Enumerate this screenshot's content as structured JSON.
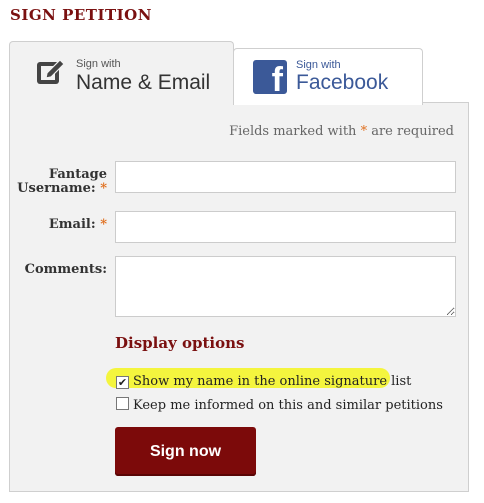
{
  "page": {
    "title": "SIGN PETITION"
  },
  "tabs": [
    {
      "small": "Sign with",
      "big": "Name & Email",
      "icon": "pencil-icon",
      "active": true
    },
    {
      "small": "Sign with",
      "big": "Facebook",
      "icon": "facebook-icon",
      "active": false
    }
  ],
  "form": {
    "required_note_before": "Fields marked with",
    "required_star": "*",
    "required_note_after": "are required",
    "fields": [
      {
        "label": "Fantage Username:",
        "value": "",
        "required": true
      },
      {
        "label": "Email:",
        "value": "",
        "required": true
      },
      {
        "label": "Comments:",
        "value": "",
        "required": false
      }
    ],
    "display_options_title": "Display options",
    "options": [
      {
        "label": "Show my name in the online signature list",
        "checked": true,
        "highlighted": true
      },
      {
        "label": "Keep me informed on this and similar petitions",
        "checked": false,
        "highlighted": false
      }
    ],
    "submit_label": "Sign now"
  },
  "colors": {
    "brand": "#7a1010",
    "button": "#7c0a0a",
    "facebook": "#3b5998",
    "required": "#e07020",
    "highlight": "#f4f53e"
  }
}
